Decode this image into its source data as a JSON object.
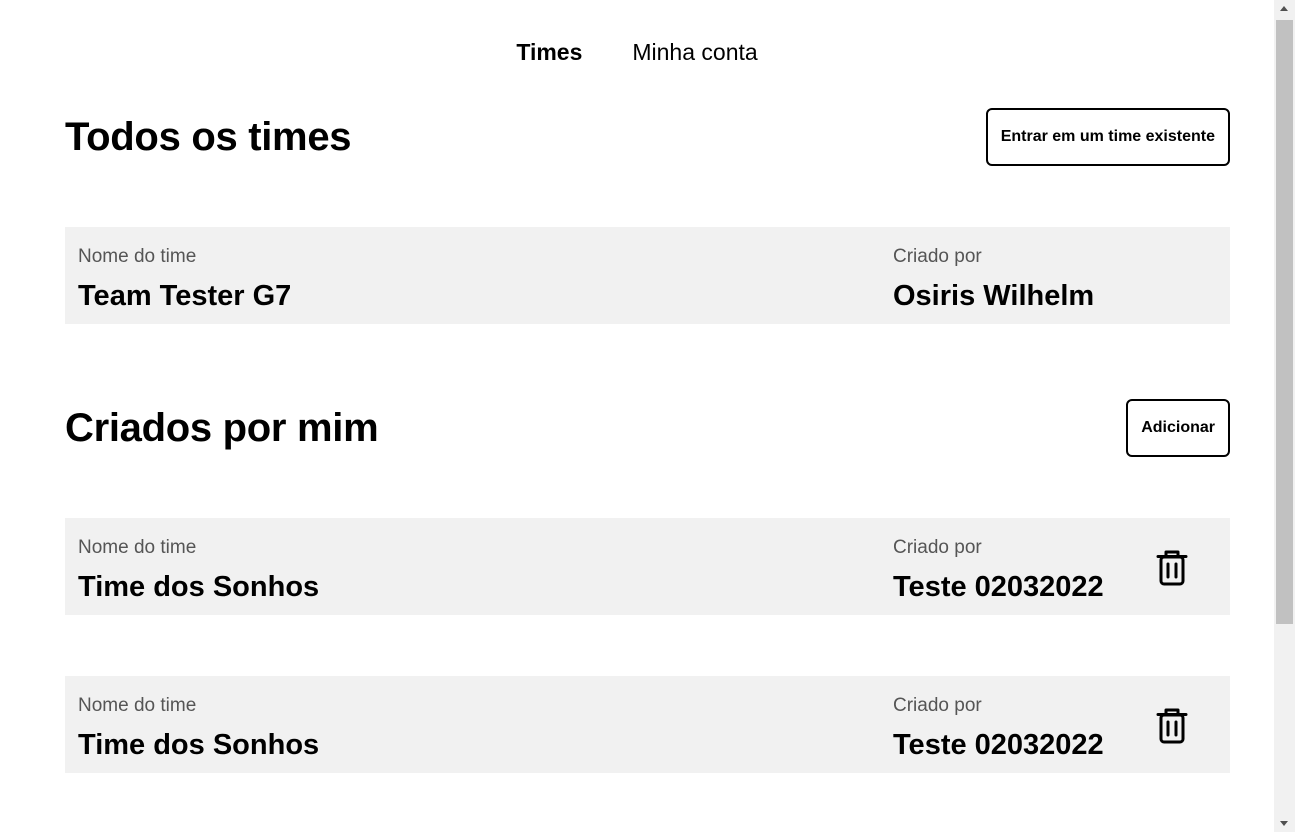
{
  "nav": {
    "items": [
      {
        "label": "Times",
        "active": true
      },
      {
        "label": "Minha conta",
        "active": false
      }
    ]
  },
  "all_teams": {
    "title": "Todos os times",
    "join_button": "Entrar em um time existente",
    "rows": [
      {
        "name_label": "Nome do time",
        "name": "Team Tester G7",
        "owner_label": "Criado por",
        "owner": "Osiris Wilhelm"
      }
    ]
  },
  "my_teams": {
    "title": "Criados por mim",
    "add_button": "Adicionar",
    "rows": [
      {
        "name_label": "Nome do time",
        "name": "Time dos Sonhos",
        "owner_label": "Criado por",
        "owner": "Teste 02032022",
        "action_icon": "trash-icon"
      },
      {
        "name_label": "Nome do time",
        "name": "Time dos Sonhos",
        "owner_label": "Criado por",
        "owner": "Teste 02032022",
        "action_icon": "trash-icon"
      }
    ]
  },
  "colors": {
    "card_bg": "#f1f1f1",
    "label_text": "#555555",
    "text": "#000000",
    "scrollbar_thumb": "#c1c1c1"
  }
}
